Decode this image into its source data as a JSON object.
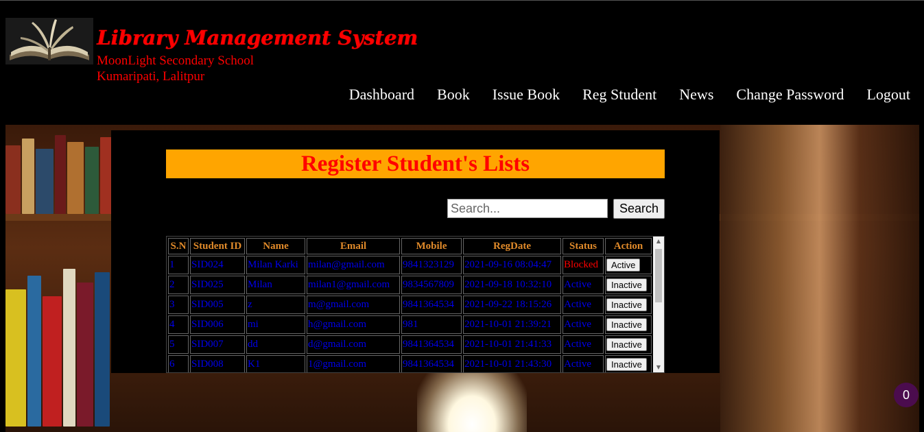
{
  "header": {
    "title": "Library Management System",
    "school": "MoonLight Secondary School",
    "address": "Kumaripati, Lalitpur"
  },
  "nav": {
    "dashboard": "Dashboard",
    "book": "Book",
    "issue_book": "Issue Book",
    "reg_student": "Reg Student",
    "news": "News",
    "change_password": "Change Password",
    "logout": "Logout"
  },
  "page": {
    "heading": "Register Student's Lists"
  },
  "search": {
    "placeholder": "Search...",
    "value": "",
    "button_label": "Search"
  },
  "table": {
    "headers": {
      "sn": "S.N",
      "student_id": "Student ID",
      "name": "Name",
      "email": "Email",
      "mobile": "Mobile",
      "regdate": "RegDate",
      "status": "Status",
      "action": "Action"
    },
    "rows": [
      {
        "sn": "1",
        "student_id": "SID024",
        "name": "Milan Karki",
        "email": "milan@gmail.com",
        "mobile": "9841323129",
        "regdate": "2021-09-16 08:04:47",
        "status": "Blocked",
        "action": "Active"
      },
      {
        "sn": "2",
        "student_id": "SID025",
        "name": "Milan",
        "email": "milan1@gmail.com",
        "mobile": "9834567809",
        "regdate": "2021-09-18 10:32:10",
        "status": "Active",
        "action": "Inactive"
      },
      {
        "sn": "3",
        "student_id": "SID005",
        "name": "z",
        "email": "m@gmail.com",
        "mobile": "9841364534",
        "regdate": "2021-09-22 18:15:26",
        "status": "Active",
        "action": "Inactive"
      },
      {
        "sn": "4",
        "student_id": "SID006",
        "name": "mi",
        "email": "h@gmail.com",
        "mobile": "981",
        "regdate": "2021-10-01 21:39:21",
        "status": "Active",
        "action": "Inactive"
      },
      {
        "sn": "5",
        "student_id": "SID007",
        "name": "dd",
        "email": "d@gmail.com",
        "mobile": "9841364534",
        "regdate": "2021-10-01 21:41:33",
        "status": "Active",
        "action": "Inactive"
      },
      {
        "sn": "6",
        "student_id": "SID008",
        "name": "K1",
        "email": "1@gmail.com",
        "mobile": "9841364534",
        "regdate": "2021-10-01 21:43:30",
        "status": "Active",
        "action": "Inactive"
      }
    ]
  },
  "notification_badge": {
    "count": "0"
  },
  "colors": {
    "brand_red": "#ff0000",
    "banner_orange": "#ffa500",
    "header_text": "#e08a2a",
    "link_blue": "#0000ee",
    "badge_purple": "#4b0c4e"
  },
  "icons": {
    "logo": "open-book-icon",
    "scroll_up": "triangle-up-icon",
    "scroll_down": "triangle-down-icon"
  }
}
